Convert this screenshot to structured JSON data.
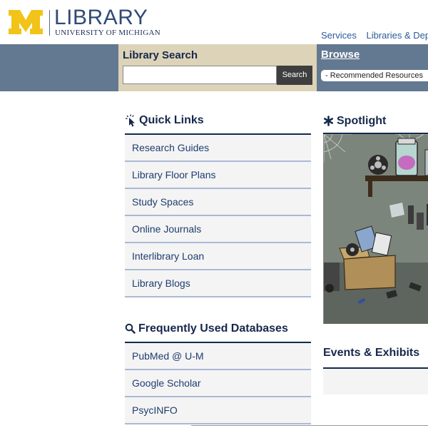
{
  "header": {
    "logo_title": "LIBRARY",
    "logo_subtitle": "UNIVERSITY OF MICHIGAN",
    "nav_links": [
      "Services",
      "Libraries & Depa"
    ]
  },
  "search": {
    "title": "Library Search",
    "input_value": "",
    "button_label": "Search"
  },
  "browse": {
    "title": "Browse",
    "selected_option": "- Recommended Resources"
  },
  "quick_links": {
    "title": "Quick Links",
    "items": [
      "Research Guides",
      "Library Floor Plans",
      "Study Spaces",
      "Online Journals",
      "Interlibrary Loan",
      "Library Blogs"
    ]
  },
  "databases": {
    "title": "Frequently Used Databases",
    "items": [
      "PubMed @ U-M",
      "Google Scholar",
      "PsycINFO"
    ]
  },
  "spotlight": {
    "title": "Spotlight"
  },
  "events": {
    "title": "Events & Exhibits"
  },
  "colors": {
    "navy": "#15284c",
    "band": "#637891",
    "search_panel": "#ddd3b8",
    "maize": "#f2c318"
  }
}
